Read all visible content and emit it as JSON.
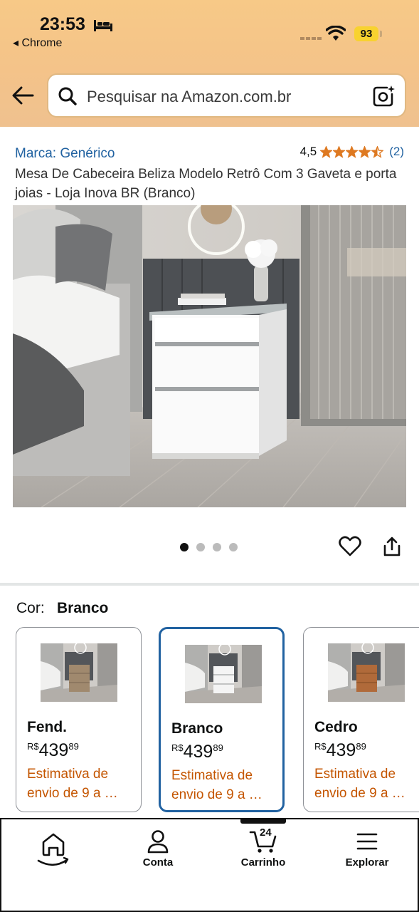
{
  "status_bar": {
    "time": "23:53",
    "back_app": "◂ Chrome",
    "battery": "93"
  },
  "search": {
    "placeholder": "Pesquisar na Amazon.com.br"
  },
  "product": {
    "brand": "Marca: Genérico",
    "rating": "4,5",
    "rating_value": 4.5,
    "rating_count": "(2)",
    "title": "Mesa De Cabeceira Beliza Modelo Retrô Com 3 Gaveta e porta joias - Loja Inova BR (Branco)",
    "image_count": 4,
    "active_image": 1
  },
  "color_selector": {
    "label": "Cor:",
    "selected": "Branco",
    "options": [
      {
        "name": "Fend.",
        "currency": "R$",
        "price_int": "439",
        "price_frac": "89",
        "shipping": "Estimativa de envio de 9 a …",
        "cabinet_color": "#a0896e"
      },
      {
        "name": "Branco",
        "currency": "R$",
        "price_int": "439",
        "price_frac": "89",
        "shipping": "Estimativa de envio de 9 a …",
        "cabinet_color": "#f4f4f4"
      },
      {
        "name": "Cedro",
        "currency": "R$",
        "price_int": "439",
        "price_frac": "89",
        "shipping": "Estimativa de envio de 9 a …",
        "cabinet_color": "#b06a3a"
      }
    ]
  },
  "bottom_nav": {
    "items": [
      {
        "label": "",
        "icon": "home-icon"
      },
      {
        "label": "Conta",
        "icon": "account-icon"
      },
      {
        "label": "Carrinho",
        "icon": "cart-icon",
        "count": "24"
      },
      {
        "label": "Explorar",
        "icon": "menu-icon"
      }
    ]
  },
  "colors": {
    "header": "#f4c389",
    "link": "#2162a1",
    "shipping": "#c45500",
    "star": "#de7921"
  }
}
